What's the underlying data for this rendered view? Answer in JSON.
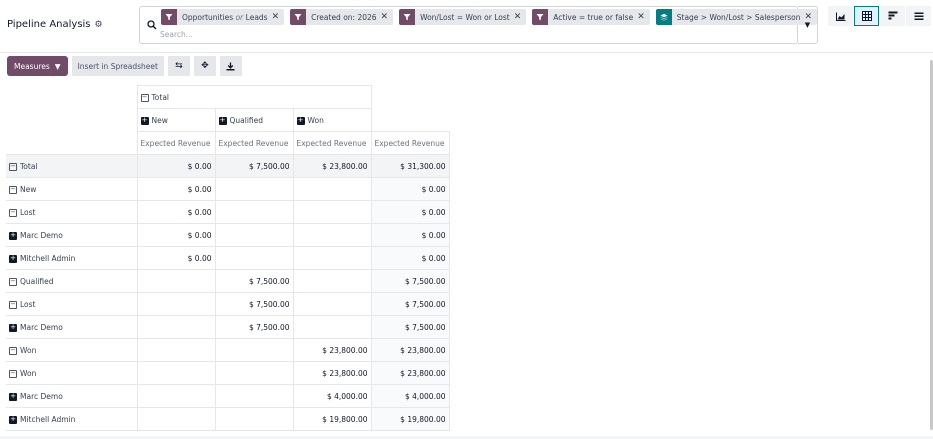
{
  "page": {
    "title": "Pipeline Analysis"
  },
  "search": {
    "placeholder": "Search...",
    "facets": [
      {
        "icon": "filter-icon",
        "text": "Opportunities",
        "sep": "or",
        "text2": "Leads"
      },
      {
        "icon": "filter-icon",
        "text": "Created on: 2026"
      },
      {
        "icon": "filter-icon",
        "text": "Won/Lost = Won or Lost"
      },
      {
        "icon": "filter-icon",
        "text": "Active = true or false"
      },
      {
        "icon": "layers-icon",
        "text": "Stage > Won/Lost > Salesperson"
      }
    ]
  },
  "views": [
    "area-chart-icon",
    "pivot-grid-icon",
    "bar-chart-icon",
    "list-icon"
  ],
  "toolbar": {
    "measures_label": "Measures",
    "spreadsheet_label": "Insert in Spreadsheet"
  },
  "pivot": {
    "col_total": "Total",
    "col_groups": [
      "New",
      "Qualified",
      "Won"
    ],
    "measure": "Expected Revenue",
    "rows": [
      {
        "label": "Total",
        "level": 0,
        "toggle": "minus",
        "cells": [
          "$ 0.00",
          "$ 7,500.00",
          "$ 23,800.00"
        ],
        "total": "$ 31,300.00"
      },
      {
        "label": "New",
        "level": 1,
        "toggle": "minus",
        "cells": [
          "$ 0.00",
          "",
          ""
        ],
        "total": "$ 0.00"
      },
      {
        "label": "Lost",
        "level": 2,
        "toggle": "minus",
        "cells": [
          "$ 0.00",
          "",
          ""
        ],
        "total": "$ 0.00"
      },
      {
        "label": "Marc Demo",
        "level": 3,
        "toggle": "plus",
        "cells": [
          "$ 0.00",
          "",
          ""
        ],
        "total": "$ 0.00"
      },
      {
        "label": "Mitchell Admin",
        "level": 3,
        "toggle": "plus",
        "cells": [
          "$ 0.00",
          "",
          ""
        ],
        "total": "$ 0.00"
      },
      {
        "label": "Qualified",
        "level": 1,
        "toggle": "minus",
        "cells": [
          "",
          "$ 7,500.00",
          ""
        ],
        "total": "$ 7,500.00"
      },
      {
        "label": "Lost",
        "level": 2,
        "toggle": "minus",
        "cells": [
          "",
          "$ 7,500.00",
          ""
        ],
        "total": "$ 7,500.00"
      },
      {
        "label": "Marc Demo",
        "level": 3,
        "toggle": "plus",
        "cells": [
          "",
          "$ 7,500.00",
          ""
        ],
        "total": "$ 7,500.00"
      },
      {
        "label": "Won",
        "level": 1,
        "toggle": "minus",
        "cells": [
          "",
          "",
          "$ 23,800.00"
        ],
        "total": "$ 23,800.00"
      },
      {
        "label": "Won",
        "level": 2,
        "toggle": "minus",
        "cells": [
          "",
          "",
          "$ 23,800.00"
        ],
        "total": "$ 23,800.00"
      },
      {
        "label": "Marc Demo",
        "level": 3,
        "toggle": "plus",
        "cells": [
          "",
          "",
          "$ 4,000.00"
        ],
        "total": "$ 4,000.00"
      },
      {
        "label": "Mitchell Admin",
        "level": 3,
        "toggle": "plus",
        "cells": [
          "",
          "",
          "$ 19,800.00"
        ],
        "total": "$ 19,800.00"
      }
    ]
  },
  "colors": {
    "primary": "#714b67",
    "teal": "#017e84"
  }
}
